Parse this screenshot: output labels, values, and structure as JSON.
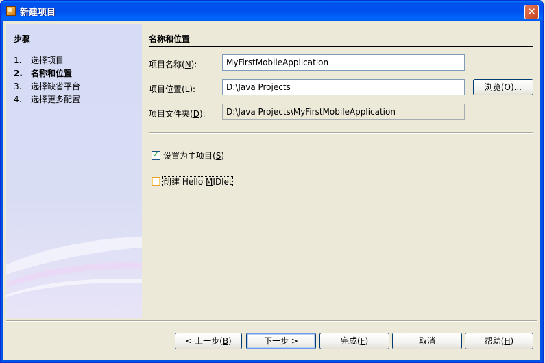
{
  "window": {
    "title": "新建项目",
    "close_glyph": "✕"
  },
  "steps": {
    "heading": "步骤",
    "items": [
      {
        "num": "1.",
        "label": "选择项目"
      },
      {
        "num": "2.",
        "label": "名称和位置"
      },
      {
        "num": "3.",
        "label": "选择缺省平台"
      },
      {
        "num": "4.",
        "label": "选择更多配置"
      }
    ],
    "current_index": 1
  },
  "form": {
    "section_title": "名称和位置",
    "project_name": {
      "label_prefix": "项目名称(",
      "mnemonic": "N",
      "label_suffix": "):",
      "value": "MyFirstMobileApplication"
    },
    "project_location": {
      "label_prefix": "项目位置(",
      "mnemonic": "L",
      "label_suffix": "):",
      "value": "D:\\Java Projects"
    },
    "project_folder": {
      "label_prefix": "项目文件夹(",
      "mnemonic": "D",
      "label_suffix": "):",
      "value": "D:\\Java Projects\\MyFirstMobileApplication"
    },
    "browse": {
      "prefix": "浏览(",
      "mnemonic": "O",
      "suffix": ")..."
    },
    "set_main": {
      "label_prefix": "设置为主项目(",
      "mnemonic": "S",
      "label_suffix": ")",
      "checked": true
    },
    "create_midlet": {
      "label_prefix": "创建 Hello ",
      "mnemonic": "M",
      "label_suffix": "IDlet",
      "checked": false
    }
  },
  "buttons": {
    "back": {
      "prefix": "< 上一步(",
      "mnemonic": "B",
      "suffix": ")"
    },
    "next": {
      "prefix": "下一步 >",
      "mnemonic": "",
      "suffix": ""
    },
    "finish": {
      "prefix": "完成(",
      "mnemonic": "F",
      "suffix": ")"
    },
    "cancel": {
      "prefix": "取消",
      "mnemonic": "",
      "suffix": ""
    },
    "help": {
      "prefix": "帮助(",
      "mnemonic": "H",
      "suffix": ")"
    }
  },
  "colors": {
    "titlebar": "#0054e3",
    "steps_panel": "#d6dbf6",
    "dialog_bg": "#ece9d8"
  }
}
